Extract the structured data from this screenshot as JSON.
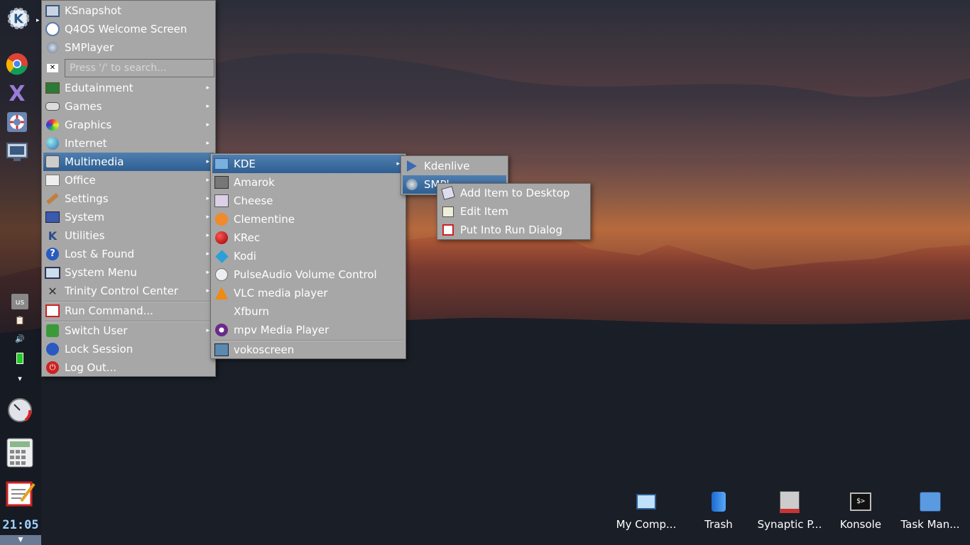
{
  "left_panel": {
    "tray": {
      "keyboard_layout": "us"
    },
    "clock": "21:05",
    "clock_dropdown": "▼"
  },
  "k_menu": {
    "recent": [
      {
        "label": "KSnapshot",
        "icon": "ksnapshot-icon"
      },
      {
        "label": "Q4OS Welcome Screen",
        "icon": "welcome-icon"
      },
      {
        "label": "SMPlayer",
        "icon": "smplayer-icon"
      }
    ],
    "search": {
      "placeholder": "Press '/' to search..."
    },
    "categories": [
      {
        "label": "Edutainment",
        "icon": "edutainment-icon"
      },
      {
        "label": "Games",
        "icon": "games-icon"
      },
      {
        "label": "Graphics",
        "icon": "graphics-icon"
      },
      {
        "label": "Internet",
        "icon": "internet-icon"
      },
      {
        "label": "Multimedia",
        "icon": "multimedia-icon"
      },
      {
        "label": "Office",
        "icon": "office-icon"
      },
      {
        "label": "Settings",
        "icon": "settings-icon"
      },
      {
        "label": "System",
        "icon": "system-icon"
      },
      {
        "label": "Utilities",
        "icon": "utilities-icon"
      },
      {
        "label": "Lost & Found",
        "icon": "lost-found-icon"
      },
      {
        "label": "System Menu",
        "icon": "system-menu-icon"
      },
      {
        "label": "Trinity Control Center",
        "icon": "control-center-icon"
      }
    ],
    "run_command": "Run Command...",
    "session": [
      {
        "label": "Switch User",
        "icon": "switch-user-icon"
      },
      {
        "label": "Lock Session",
        "icon": "lock-icon"
      },
      {
        "label": "Log Out...",
        "icon": "logout-icon"
      }
    ]
  },
  "multimedia_menu": {
    "items": [
      {
        "label": "KDE",
        "icon": "folder-icon"
      },
      {
        "label": "Amarok",
        "icon": "amarok-icon"
      },
      {
        "label": "Cheese",
        "icon": "cheese-icon"
      },
      {
        "label": "Clementine",
        "icon": "clementine-icon"
      },
      {
        "label": "KRec",
        "icon": "krec-icon"
      },
      {
        "label": "Kodi",
        "icon": "kodi-icon"
      },
      {
        "label": "PulseAudio Volume Control",
        "icon": "pulseaudio-icon"
      },
      {
        "label": "VLC media player",
        "icon": "vlc-icon"
      },
      {
        "label": "Xfburn",
        "icon": "xfburn-icon"
      },
      {
        "label": "mpv Media Player",
        "icon": "mpv-icon"
      }
    ],
    "extra": {
      "label": "vokoscreen",
      "icon": "vokoscreen-icon"
    }
  },
  "kde_menu": {
    "items": [
      {
        "label": "Kdenlive",
        "icon": "kdenlive-icon"
      },
      {
        "label": "SMPl",
        "icon": "smplayer-icon"
      }
    ]
  },
  "context_menu": {
    "items": [
      {
        "label": "Add Item to Desktop",
        "icon": "add-desktop-icon"
      },
      {
        "label": "Edit Item",
        "icon": "edit-icon"
      },
      {
        "label": "Put Into Run Dialog",
        "icon": "run-dialog-icon"
      }
    ]
  },
  "desktop_icons": [
    {
      "label": "My Comp...",
      "icon": "computer-icon"
    },
    {
      "label": "Trash",
      "icon": "trash-icon"
    },
    {
      "label": "Synaptic P...",
      "icon": "synaptic-icon"
    },
    {
      "label": "Konsole",
      "icon": "konsole-icon"
    },
    {
      "label": "Task Man...",
      "icon": "task-manager-icon"
    }
  ],
  "colors": {
    "menu_bg": "#a7a7a7",
    "selection": "#3a6a9e",
    "clock": "#9fd1ff"
  }
}
